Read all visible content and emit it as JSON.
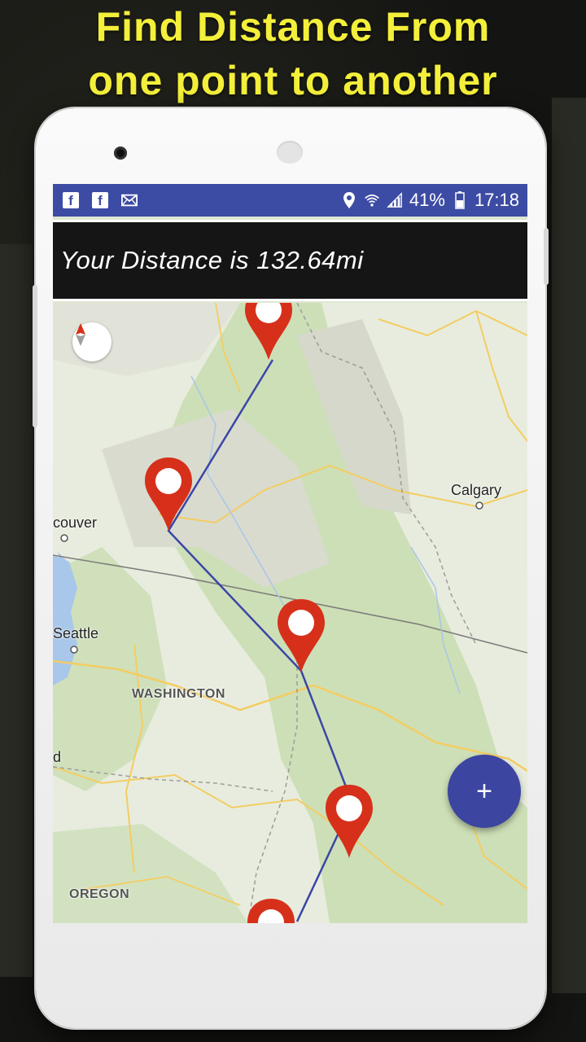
{
  "promo": {
    "line1": "Find Distance  From",
    "line2": "one point to another"
  },
  "status_bar": {
    "left_icons": [
      "facebook-icon",
      "facebook-icon",
      "mail-icon"
    ],
    "battery": "41%",
    "time": "17:18",
    "color": "#3c4ba3"
  },
  "distance": {
    "text": "Your Distance is 132.64mi"
  },
  "map": {
    "labels": {
      "calgary": "Calgary",
      "vancouver": "couver",
      "seattle": "Seattle",
      "washington": "WASHINGTON",
      "oregon": "OREGON",
      "partial_d": "d"
    },
    "route_color": "#3b46a6",
    "marker_color": "#d6301a",
    "marker_count": 5
  },
  "fab": {
    "label": "+",
    "color": "#3c45a0"
  },
  "compass": {
    "icon": "compass-icon"
  }
}
